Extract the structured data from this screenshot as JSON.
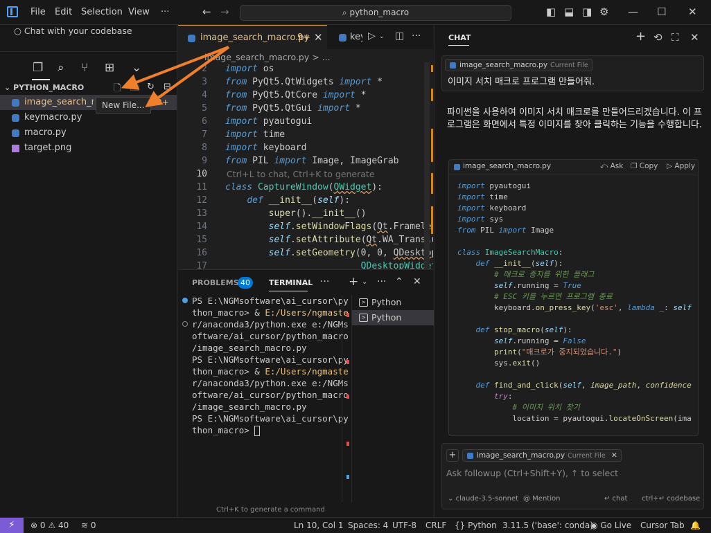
{
  "titlebar": {
    "menu": [
      "File",
      "Edit",
      "Selection",
      "View"
    ],
    "more": "···",
    "search": "python_macro"
  },
  "sidebar": {
    "chat_codebase": "Chat with your codebase",
    "explorer_title": "PYTHON_MACRO",
    "tooltip": "New File...",
    "files": [
      {
        "name": "image_search_macro.py",
        "badge": "9+",
        "type": "python",
        "active": true
      },
      {
        "name": "keymacro.py",
        "type": "python"
      },
      {
        "name": "macro.py",
        "type": "python"
      },
      {
        "name": "target.png",
        "type": "image"
      }
    ]
  },
  "editor": {
    "active_tab": "image_search_macro.py",
    "active_tab_badge": "9+",
    "second_tab": "keymacro.py",
    "breadcrumb": "image_search_macro.py > ...",
    "hint": "Ctrl+L to chat, Ctrl+K to generate",
    "line_numbers": [
      "2",
      "3",
      "4",
      "5",
      "6",
      "7",
      "8",
      "9",
      "10",
      "11",
      "12",
      "13",
      "14",
      "15",
      "16",
      "17"
    ],
    "current_line": "10"
  },
  "panel": {
    "problems_label": "PROBLEMS",
    "problems_count": "40",
    "terminal_label": "TERMINAL",
    "terminal_lines": [
      "PS E:\\NGMsoftware\\ai_cursor\\py",
      "thon_macro> & E:/Users/ngmaste",
      "r/anaconda3/python.exe e:/NGMs",
      "oftware/ai_cursor/python_macro",
      "/image_search_macro.py",
      "PS E:\\NGMsoftware\\ai_cursor\\py",
      "thon_macro> & E:/Users/ngmaste",
      "r/anaconda3/python.exe e:/NGMs",
      "oftware/ai_cursor/python_macro",
      "/image_search_macro.py",
      "PS E:\\NGMsoftware\\ai_cursor\\py",
      "thon_macro> "
    ],
    "terminals": [
      "Python",
      "Python"
    ],
    "hint": "Ctrl+K to generate a command"
  },
  "chat": {
    "title": "CHAT",
    "context_file": "image_search_macro.py",
    "context_tag": "Current File",
    "user_message": "이미지 서치 매크로 프로그램 만들어줘.",
    "assistant_text": "파이썬을 사용하여 이미지 서치 매크로를 만들어드리겠습니다. 이 프로그램은 화면에서 특정 이미지를 찾아 클릭하는 기능을 수행합니다.",
    "code_file": "image_search_macro.py",
    "ask": "Ask",
    "copy": "Copy",
    "apply": "Apply",
    "input_placeholder": "Ask followup (Ctrl+Shift+Y), ↑ to select",
    "model": "claude-3.5-sonnet",
    "mention": "@ Mention",
    "chat_shortcut": "↵ chat",
    "codebase_shortcut": "ctrl+↵ codebase"
  },
  "statusbar": {
    "errors": "0",
    "warnings": "40",
    "ports": "0",
    "position": "Ln 10, Col 1",
    "spaces": "Spaces: 4",
    "encoding": "UTF-8",
    "eol": "CRLF",
    "language": "Python",
    "interpreter": "3.11.5 ('base': conda)",
    "golive": "Go Live",
    "cursor_tab": "Cursor Tab"
  },
  "colors": {
    "accent": "#0078d4",
    "remote": "#7b5cd6",
    "annotation_arrow": "#f07f2c",
    "modified": "#e2c08d"
  }
}
